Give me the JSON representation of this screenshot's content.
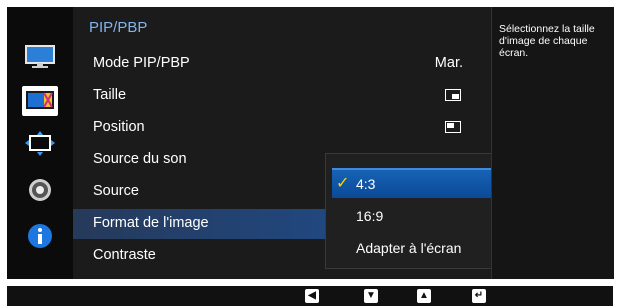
{
  "menu": {
    "title": "PIP/PBP",
    "items": [
      {
        "label": "Mode PIP/PBP",
        "value": "Mar."
      },
      {
        "label": "Taille",
        "icon": "pip-size-icon"
      },
      {
        "label": "Position",
        "icon": "pip-position-icon"
      },
      {
        "label": "Source du son"
      },
      {
        "label": "Source"
      },
      {
        "label": "Format de l'image"
      },
      {
        "label": "Contraste"
      }
    ]
  },
  "sidebar_icons": [
    "picture-icon",
    "color-icon",
    "size-position-icon",
    "settings-icon",
    "info-icon"
  ],
  "dropdown": {
    "options": [
      "4:3",
      "16:9",
      "Adapter à l'écran"
    ],
    "selected": "4:3"
  },
  "help_text": "Sélectionnez la taille d'image de chaque écran.",
  "footer_buttons": [
    "left-arrow-icon",
    "down-arrow-icon",
    "up-arrow-icon",
    "enter-icon"
  ],
  "colors": {
    "accent_blue": "#1d5eb0",
    "title_blue": "#7fb4ef",
    "checkmark": "#ffd400"
  }
}
